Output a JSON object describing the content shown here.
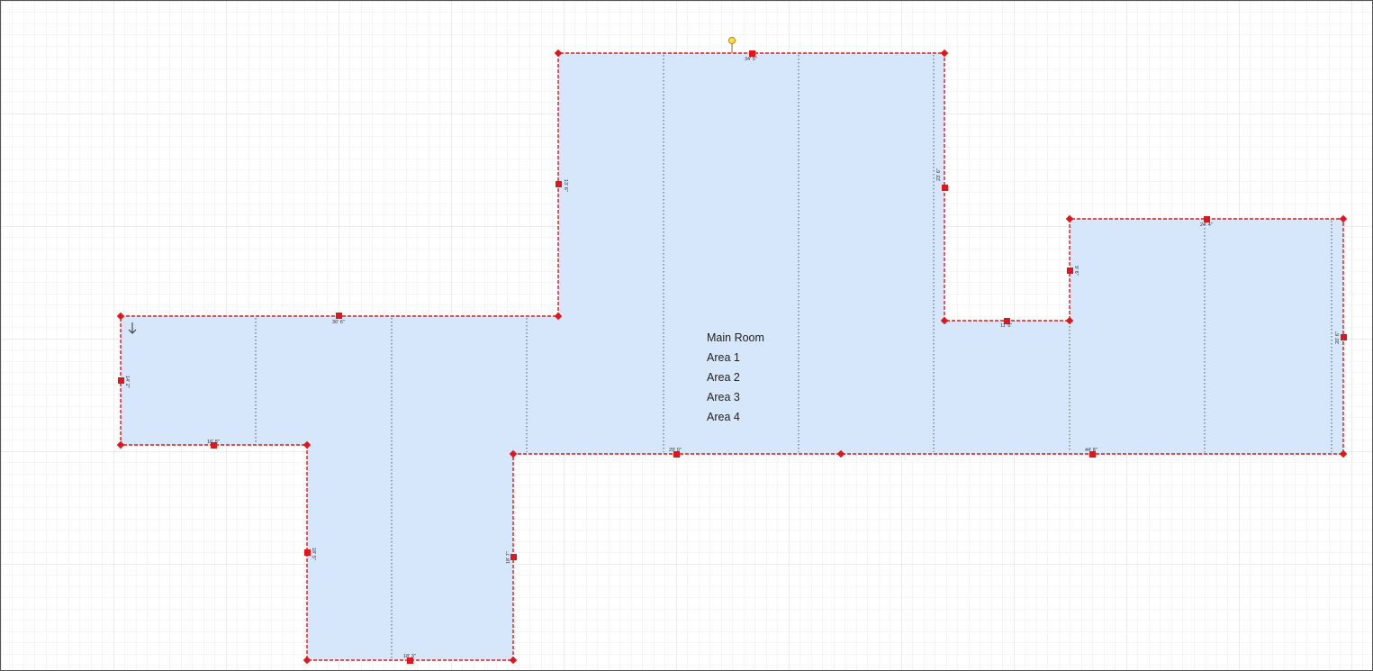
{
  "room": {
    "labels": [
      "Main Room",
      "Area 1",
      "Area 2",
      "Area 3",
      "Area 4"
    ]
  },
  "dimensions": {
    "top": "34' 5\"",
    "upper_left": "13' 6\"",
    "upper_right": "23' 6\"",
    "left_top": "30' 6\"",
    "left_side": "14' 2\"",
    "left_bottom": "16' 8\"",
    "mid_bottom": "29' 0\"",
    "notch": "11' 6\"",
    "right_top": "24' 4\"",
    "right_notch_side": "9' 6\"",
    "right_side": "20' 6\"",
    "right_bottom": "44' 8\"",
    "bottom": "18' 3\"",
    "bottom_left_side": "18' 5\"",
    "bottom_right_side": "18' 7\""
  },
  "colors": {
    "fill": "#d6e6fb",
    "outline": "#e0161b",
    "handle": "#e0161b",
    "rotate_handle": "#ffd94a",
    "grid_minor": "#ececec",
    "grid_major": "#dcdcdc"
  },
  "icons": {
    "rotate_handle": "rotate-handle-icon",
    "direction": "arrow-down-icon"
  }
}
